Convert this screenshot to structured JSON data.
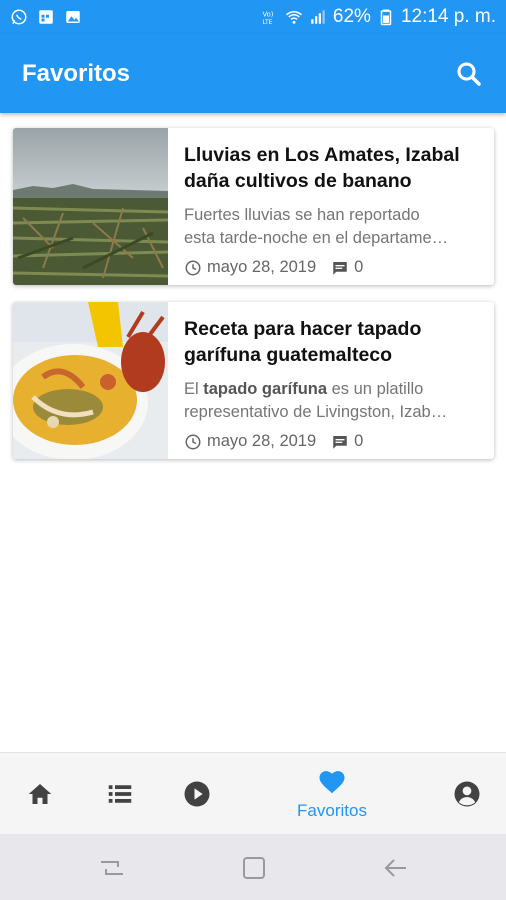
{
  "status_bar": {
    "battery": "62%",
    "time": "12:14 p. m.",
    "network_label": "Vo) LTE",
    "icons": [
      "whatsapp-icon",
      "calendar-icon",
      "gallery-icon",
      "volte-icon",
      "wifi-icon",
      "signal-icon",
      "battery-icon"
    ]
  },
  "app_bar": {
    "title": "Favoritos",
    "actions": [
      "search-icon"
    ]
  },
  "articles": [
    {
      "title": "Lluvias en Los Amates, Izabal daña cultivos de banano",
      "excerpt_line1": "Fuertes lluvias se han reportado",
      "excerpt_line2": "esta tarde-noche en el departame…",
      "date": "mayo 28, 2019",
      "comments": "0"
    },
    {
      "title": "Receta para hacer tapado garífuna guatemalteco",
      "excerpt_prefix": "El ",
      "excerpt_bold": "tapado garífuna",
      "excerpt_suffix": " es un platillo",
      "excerpt_line2": "representativo de Livingston, Izab…",
      "date": "mayo 28, 2019",
      "comments": "0"
    }
  ],
  "bottom_nav": {
    "items": [
      "home-icon",
      "list-icon",
      "play-icon",
      "heart-icon",
      "account-icon"
    ],
    "active_label": "Favoritos"
  },
  "colors": {
    "primary": "#2196f3",
    "nav_inactive": "#424242"
  }
}
